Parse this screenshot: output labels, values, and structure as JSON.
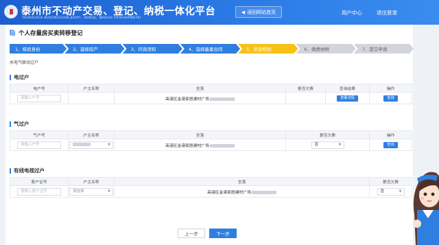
{
  "header": {
    "title": "泰州市不动产交易、登记、纳税一体化平台",
    "title_pinyin": "TAIZHOUSHI BUDONGCHAN JIAOYI、DENGJI、NASHUI YITIHUAPINGTAI",
    "home_button": "返回网站首页",
    "user_center": "用户中心",
    "logout": "退出登录"
  },
  "page": {
    "title": "个人存量房买卖转移登记",
    "subtitle": "水电气联动过户"
  },
  "steps": [
    {
      "label": "1、核验身份",
      "state": "done"
    },
    {
      "label": "2、选择房产",
      "state": "done"
    },
    {
      "label": "3、问询须知",
      "state": "done"
    },
    {
      "label": "4、选择备案合同",
      "state": "done"
    },
    {
      "label": "5、信息校验",
      "state": "active"
    },
    {
      "label": "6、缴费纳税",
      "state": "todo"
    },
    {
      "label": "7、提交申请",
      "state": "todo"
    }
  ],
  "electric": {
    "heading": "电过户",
    "columns": [
      "电户号",
      "户主名称",
      "坐落",
      "是否欠费",
      "查询结果",
      "操作"
    ],
    "row": {
      "account_placeholder": "请输入户号",
      "owner": "",
      "address": "高港区金港家居建材广场",
      "address_masked": "█████",
      "arrears": "",
      "result_button": "查看详情",
      "action_button": "查询"
    }
  },
  "gas": {
    "heading": "气过户",
    "columns": [
      "气户号",
      "户主名称",
      "坐落",
      "是否欠费",
      "操作"
    ],
    "row": {
      "account_placeholder": "请输入户号",
      "owner_masked": "███",
      "address": "高港区金港家居建材广场",
      "address_masked": "█████",
      "arrears_value": "否",
      "action_button": "查询"
    }
  },
  "cable": {
    "heading": "有线电视过户",
    "columns": [
      "客户证号",
      "户主名称",
      "坐落",
      "是否欠费"
    ],
    "row": {
      "account_placeholder": "请输入客户证号",
      "owner_placeholder": "请选择",
      "address": "高港区金港家居建材广场",
      "address_masked": "█████",
      "arrears_value": "否"
    }
  },
  "footer": {
    "prev": "上一步",
    "next": "下一步"
  },
  "colors": {
    "header_blue": "#1c5fd0",
    "step_done": "#2f7fe0",
    "step_active": "#f7c218",
    "step_todo": "#d2d5da"
  }
}
